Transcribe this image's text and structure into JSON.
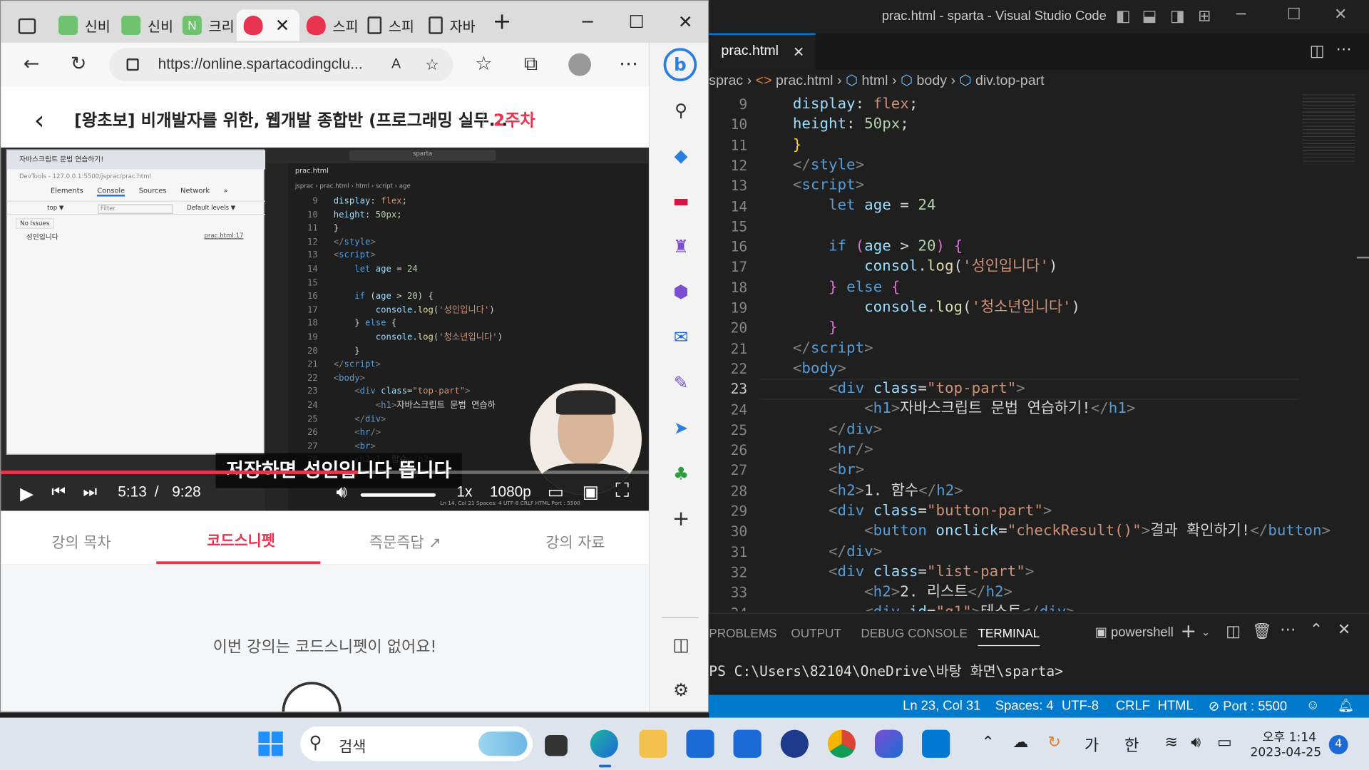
{
  "edge": {
    "tabs": [
      {
        "label": "신비"
      },
      {
        "label": "신비"
      },
      {
        "label": "크리"
      },
      {
        "label": ""
      },
      {
        "label": "스피"
      },
      {
        "label": "스피"
      },
      {
        "label": "자바"
      }
    ],
    "url": "https://online.spartacodingclu...",
    "course_title": "[왕초보] 비개발자를 위한, 웹개발 종합반 (프로그래밍 실무...",
    "week": "2주차",
    "subtitle": "저장하면 성인입니다 뜹니다",
    "time_current": "5:13",
    "time_sep": "/",
    "time_total": "9:28",
    "speed": "1x",
    "quality": "1080p",
    "lesson_tabs": [
      "강의 목차",
      "코드스니펫",
      "즉문즉답",
      "강의 자료"
    ],
    "empty_message": "이번 강의는 코드스니펫이 없어요!",
    "mini_devtools": {
      "tab_title": "자바스크립트 문법 연습하기!",
      "title": "DevTools - 127.0.0.1:5500/jsprac/prac.html",
      "tabs": [
        "Elements",
        "Console",
        "Sources",
        "Network",
        "»"
      ],
      "context": "top ▼",
      "filter": "Filter",
      "levels": "Default levels ▼",
      "issues": "No Issues",
      "log_text": "성인입니다",
      "log_src": "prac.html:17"
    },
    "mini_vscode": {
      "search": "sparta",
      "file_tab": "prac.html",
      "breadcrumb": "jsprac › prac.html › html › script › age",
      "line_numbers": [
        "9",
        "10",
        "11",
        "12",
        "13",
        "14",
        "15",
        "16",
        "17",
        "18",
        "19",
        "20",
        "21",
        "22",
        "23",
        "24",
        "25",
        "26",
        "27",
        "28"
      ],
      "status": "Ln 14, Col 21   Spaces: 4   UTF-8   CRLF   HTML   Port : 5500"
    }
  },
  "vscode": {
    "window_title": "prac.html - sparta - Visual Studio Code",
    "file_tab": "prac.html",
    "breadcrumb": [
      "sprac",
      "prac.html",
      "html",
      "body",
      "div.top-part"
    ],
    "panel_tabs": [
      "PROBLEMS",
      "OUTPUT",
      "DEBUG CONSOLE",
      "TERMINAL"
    ],
    "shell": "powershell",
    "terminal_prompt": "PS C:\\Users\\82104\\OneDrive\\바탕 화면\\sparta>",
    "status": {
      "position": "Ln 23, Col 31",
      "spaces": "Spaces: 4",
      "encoding": "UTF-8",
      "eol": "CRLF",
      "language": "HTML",
      "port": "Port : 5500"
    },
    "line_numbers": [
      "9",
      "10",
      "11",
      "12",
      "13",
      "14",
      "15",
      "16",
      "17",
      "18",
      "19",
      "20",
      "21",
      "22",
      "23",
      "24",
      "25",
      "26",
      "27",
      "28",
      "29",
      "30",
      "31",
      "32",
      "33",
      "34"
    ]
  },
  "taskbar": {
    "search_placeholder": "검색",
    "ime_mode": "가",
    "ime_lang": "한",
    "time": "오후 1:14",
    "date": "2023-04-25",
    "notifications": "4"
  },
  "colors": {
    "accent_red": "#e8344e",
    "vscode_bg": "#1f1f1f",
    "statusbar": "#007acc"
  }
}
